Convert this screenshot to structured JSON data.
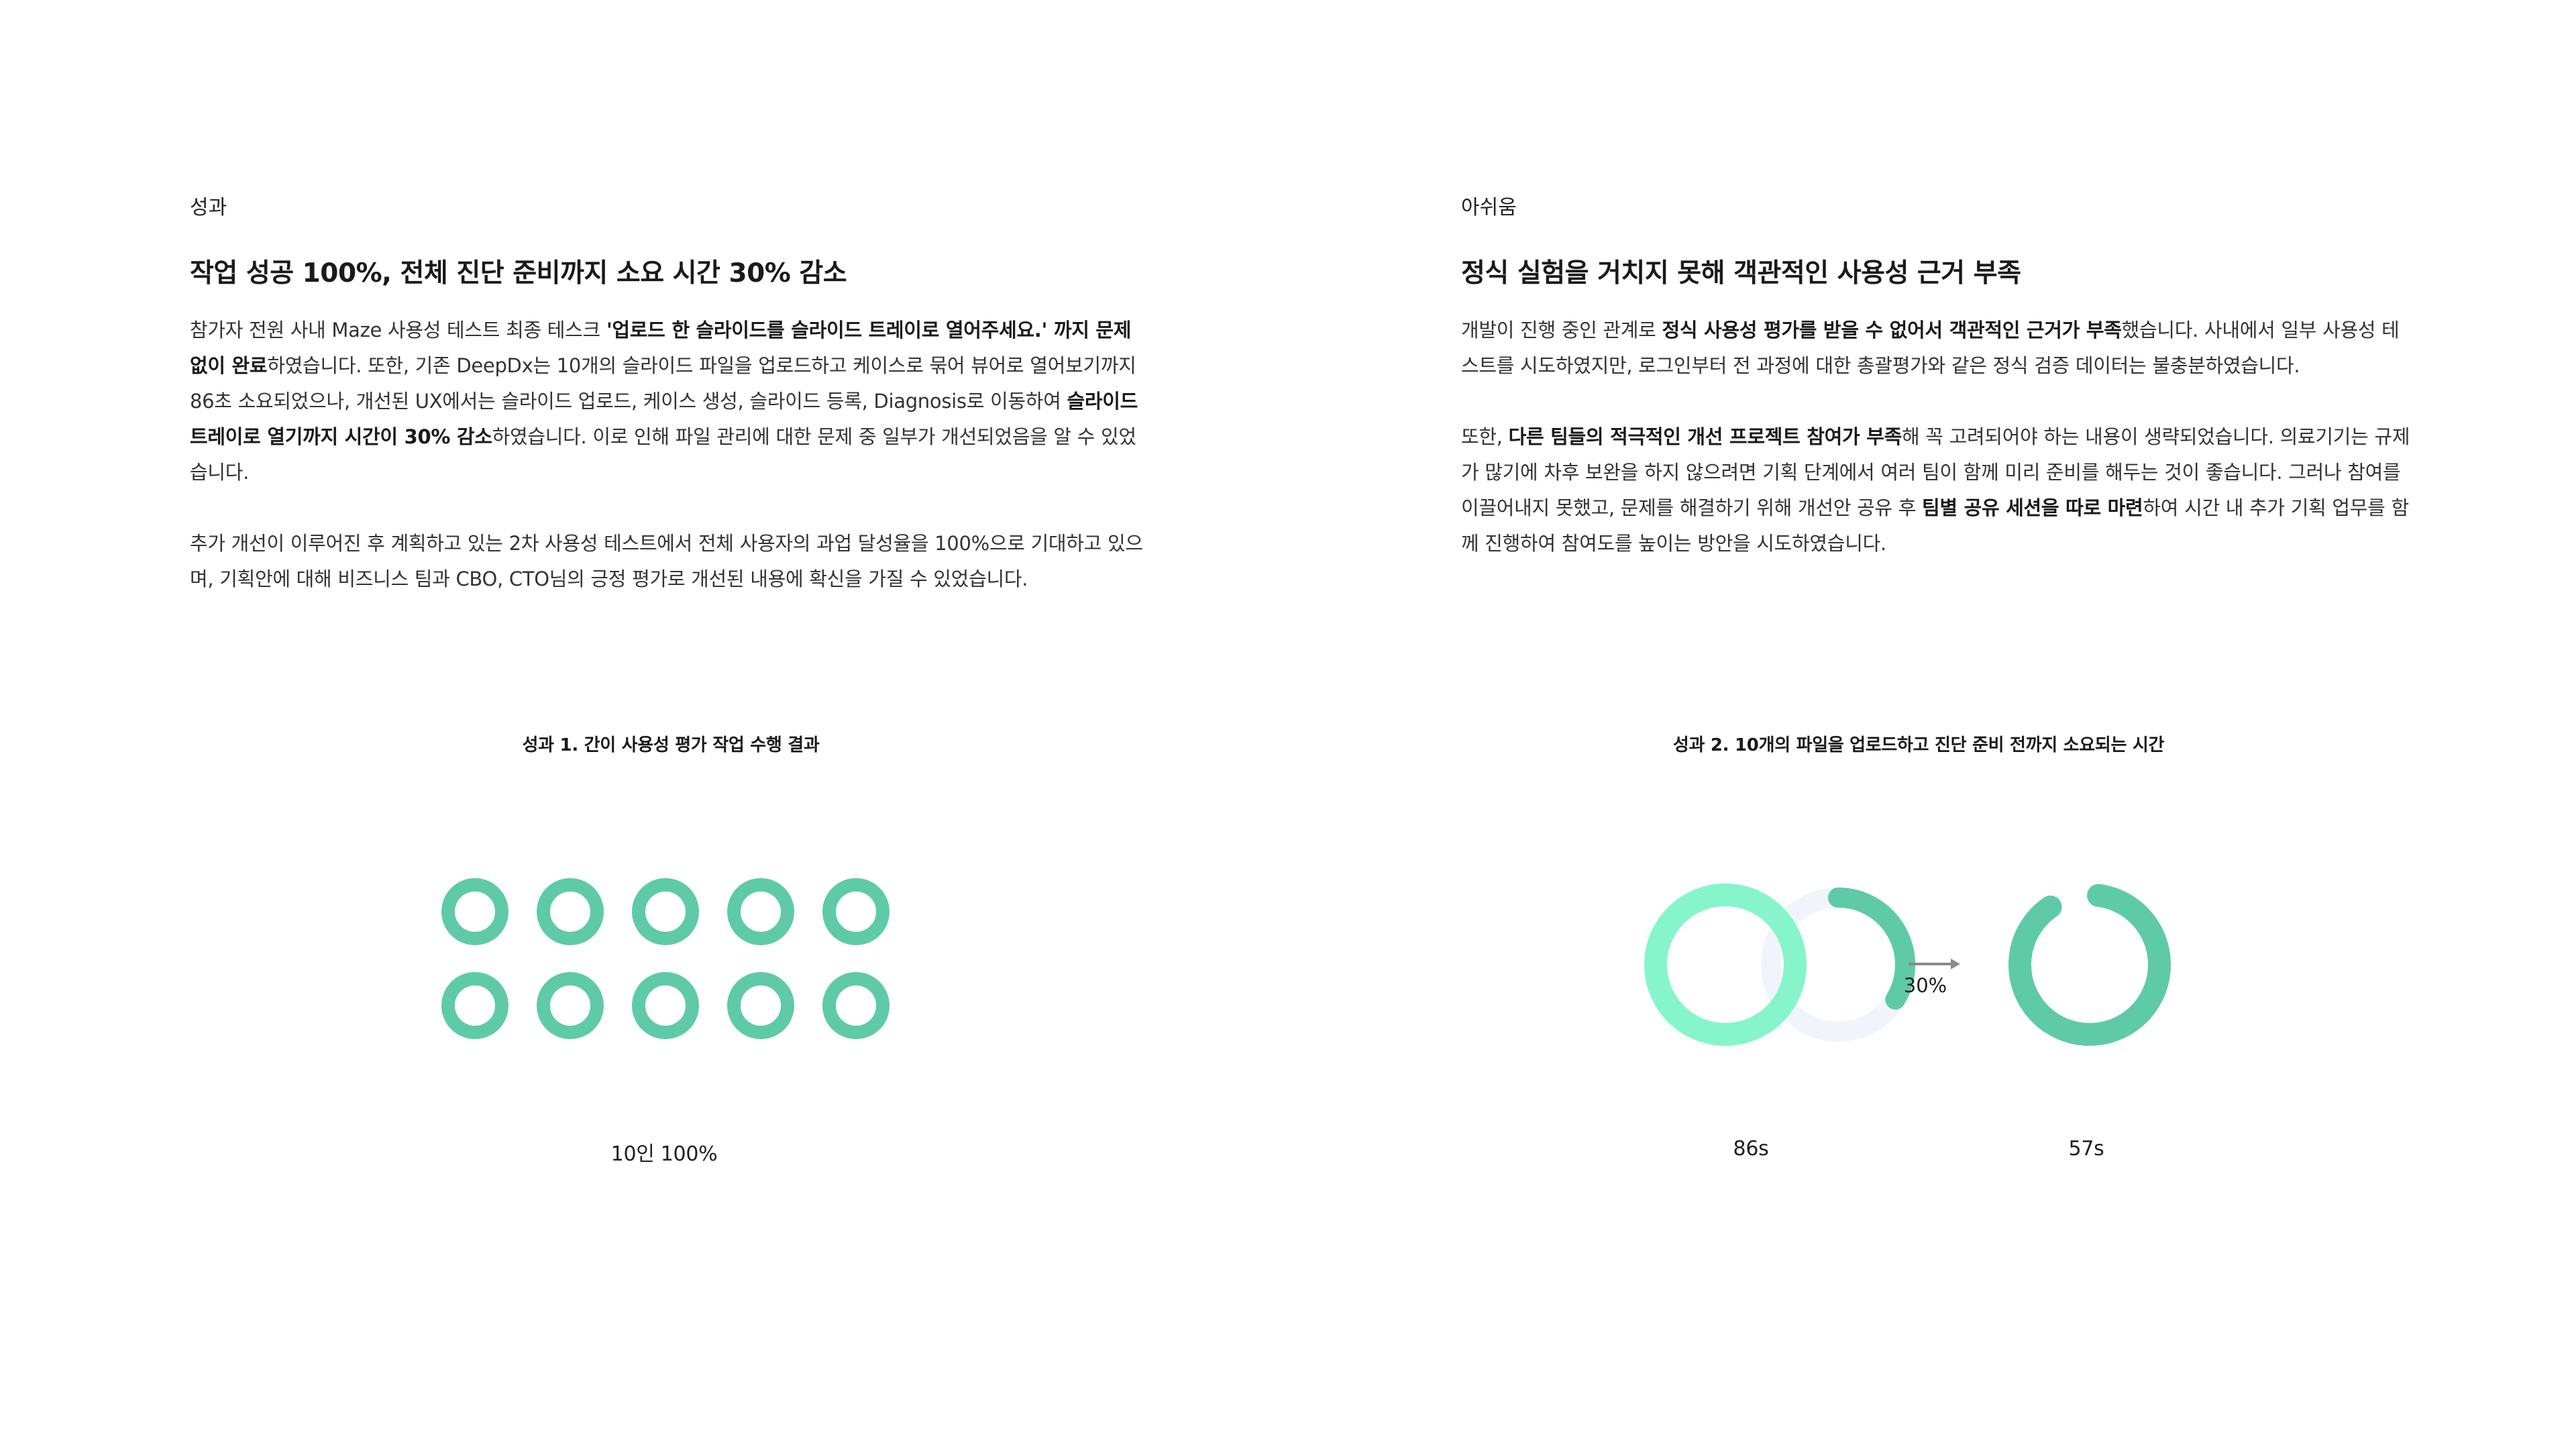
{
  "left": {
    "eyebrow": "성과",
    "heading": "작업 성공 100%, 전체 진단 준비까지 소요 시간 30% 감소",
    "para1": [
      {
        "text": "참가자 전원 사내 Maze 사용성 테스트 최종 테스크 ",
        "bold": false
      },
      {
        "text": "'업로드 한 슬라이드를 슬라이드 트레이로 열어주세요.' 까지 문제 없이 완료",
        "bold": true
      },
      {
        "text": "하였습니다. 또한, 기존 DeepDx는 10개의 슬라이드 파일을 업로드하고 케이스로 묶어 뷰어로 열어보기까지 86초 소요되었으나, 개선된 UX에서는 슬라이드 업로드, 케이스 생성, 슬라이드 등록, Diagnosis로 이동하여 ",
        "bold": false
      },
      {
        "text": "슬라이드 트레이로 열기까지 시간이 30% 감소",
        "bold": true
      },
      {
        "text": "하였습니다. 이로 인해 파일 관리에 대한 문제 중 일부가 개선되었음을 알 수 있었습니다.",
        "bold": false
      }
    ],
    "para2": [
      {
        "text": "추가 개선이 이루어진 후 계획하고 있는 2차 사용성 테스트에서 전체 사용자의 과업 달성율을 100%으로 기대하고 있으며, 기획안에 대해 비즈니스 팀과 CBO, CTO님의 긍정 평가로 개선된 내용에 확신을 가질 수 있었습니다.",
        "bold": false
      }
    ]
  },
  "right": {
    "eyebrow": "아쉬움",
    "heading": "정식 실험을 거치지 못해 객관적인 사용성 근거 부족",
    "para1": [
      {
        "text": "개발이 진행 중인 관계로 ",
        "bold": false
      },
      {
        "text": "정식 사용성 평가를 받을 수 없어서 객관적인 근거가 부족",
        "bold": true
      },
      {
        "text": "했습니다. 사내에서 일부 사용성 테스트를 시도하였지만, 로그인부터 전 과정에 대한 총괄평가와 같은 정식 검증 데이터는 불충분하였습니다.",
        "bold": false
      }
    ],
    "para2": [
      {
        "text": "또한, ",
        "bold": false
      },
      {
        "text": "다른 팀들의 적극적인 개선 프로젝트 참여가 부족",
        "bold": true
      },
      {
        "text": "해 꼭 고려되어야 하는 내용이 생략되었습니다. 의료기기는 규제가 많기에 차후 보완을 하지 않으려면 기획 단계에서 여러 팀이 함께 미리 준비를 해두는 것이 좋습니다. 그러나 참여를 이끌어내지 못했고, 문제를 해결하기 위해 개선안 공유 후 ",
        "bold": false
      },
      {
        "text": "팀별 공유 세션을 따로 마련",
        "bold": true
      },
      {
        "text": "하여 시간 내 추가 기획 업무를 함께 진행하여 참여도를 높이는 방안을 시도하였습니다.",
        "bold": false
      }
    ]
  },
  "chart_data": [
    {
      "type": "pictogram",
      "title": "성과 1. 간이 사용성 평가 작업 수행 결과",
      "participants": 10,
      "completed": 10,
      "label": "10인 100%",
      "color": "#5ecba6"
    },
    {
      "type": "comparison-donut",
      "title": "성과 2. 10개의 파일을 업로드하고 진단 준비 전까지 소요되는 시간",
      "before": {
        "value_s": 86,
        "label": "86s",
        "color": "#86f5cb"
      },
      "after": {
        "value_s": 57,
        "label": "57s",
        "color": "#5ecba6"
      },
      "reduction_label": "30%",
      "ghost_color": "#f1f4fb",
      "reduced_arc_color": "#5ecba6",
      "arrow_color": "#8a8a8a"
    }
  ]
}
